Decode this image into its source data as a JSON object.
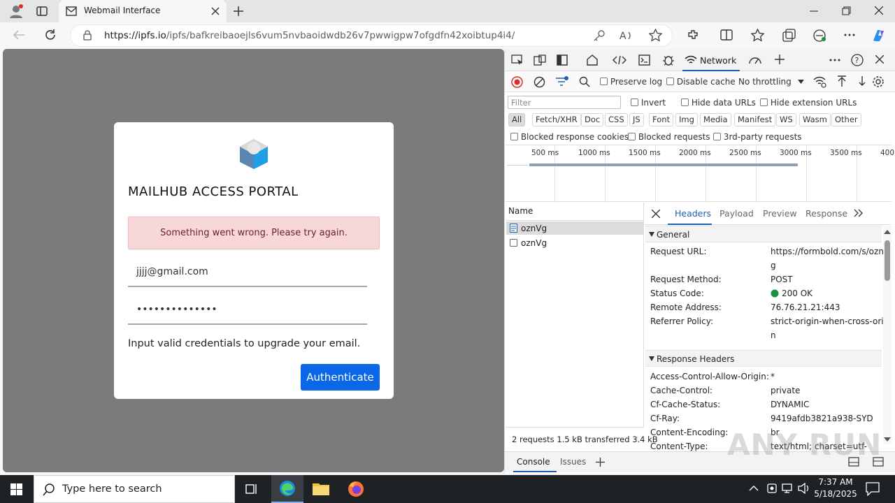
{
  "browser": {
    "tab_title": "Webmail Interface",
    "url_host": "https://ipfs.io",
    "url_path": "/ipfs/bafkreibaoejls6vum5nvbaoidwdb26v7pwwigpw7ofgdfn42xoibtup4i4/"
  },
  "page": {
    "heading": "MAILHUB  ACCESS PORTAL",
    "alert": "Something went wrong. Please try again.",
    "email_value": "jjjj@gmail.com",
    "password_value": "••••••••••••••",
    "info": "Input valid credentials to upgrade your email.",
    "button": "Authenticate"
  },
  "devtools": {
    "network_tab": "Network",
    "preserve_log": "Preserve log",
    "disable_cache": "Disable cache",
    "throttling": "No throttling",
    "filter_placeholder": "Filter",
    "invert": "Invert",
    "hide_data_urls": "Hide data URLs",
    "hide_ext_urls": "Hide extension URLs",
    "filter_types": [
      "All",
      "Fetch/XHR",
      "Doc",
      "CSS",
      "JS",
      "Font",
      "Img",
      "Media",
      "Manifest",
      "WS",
      "Wasm",
      "Other"
    ],
    "blocked_cookies": "Blocked response cookies",
    "blocked_requests": "Blocked requests",
    "third_party": "3rd-party requests",
    "timeline_labels": [
      "500 ms",
      "1000 ms",
      "1500 ms",
      "2000 ms",
      "2500 ms",
      "3000 ms",
      "3500 ms",
      "400"
    ],
    "name_header": "Name",
    "requests": [
      "oznVg",
      "oznVg"
    ],
    "summary": "2 requests   1.5 kB transferred   3.4 kB",
    "detail_tabs": [
      "Headers",
      "Payload",
      "Preview",
      "Response"
    ],
    "general_title": "General",
    "general": {
      "req_url_k": "Request URL:",
      "req_url_v1": "https://formbold.com/s/oznV",
      "req_url_v2": "g",
      "method_k": "Request Method:",
      "method_v": "POST",
      "status_k": "Status Code:",
      "status_v": "200 OK",
      "remote_k": "Remote Address:",
      "remote_v": "76.76.21.21:443",
      "referrer_k": "Referrer Policy:",
      "referrer_v1": "strict-origin-when-cross-origi",
      "referrer_v2": "n"
    },
    "response_title": "Response Headers",
    "response": {
      "acao_k": "Access-Control-Allow-Origin:",
      "acao_v": "*",
      "cc_k": "Cache-Control:",
      "cc_v": "private",
      "cfs_k": "Cf-Cache-Status:",
      "cfs_v": "DYNAMIC",
      "ray_k": "Cf-Ray:",
      "ray_v": "9419afdb3821a938-SYD",
      "ce_k": "Content-Encoding:",
      "ce_v": "br",
      "ct_k": "Content-Type:",
      "ct_v": "text/html; charset=utf-"
    },
    "drawer_console": "Console",
    "drawer_issues": "Issues"
  },
  "taskbar": {
    "search_placeholder": "Type here to search",
    "time": "7:37 AM",
    "date": "5/18/2025"
  },
  "watermark": "ANY RUN",
  "colors": {
    "accent": "#0a68e8",
    "alert_bg": "#f8d7da",
    "status_green": "#1e8e3e"
  }
}
